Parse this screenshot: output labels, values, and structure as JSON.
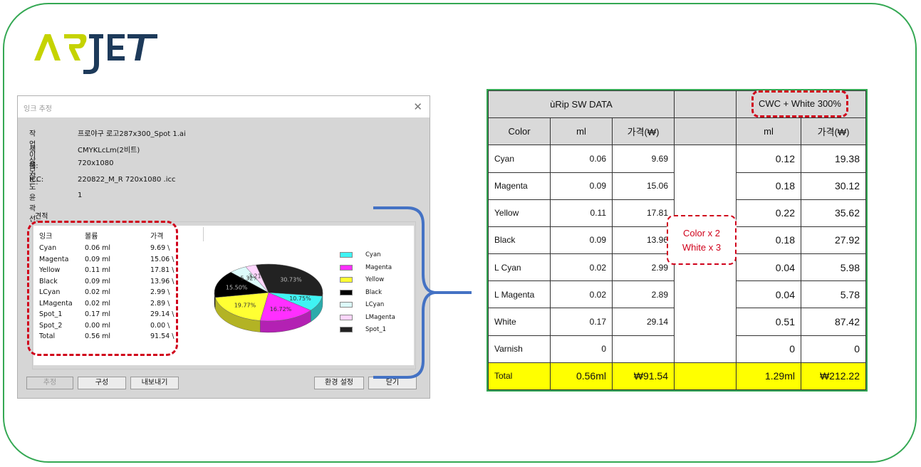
{
  "dialog": {
    "title": "잉크 추정",
    "fields": [
      {
        "key": "작업 이름:",
        "value": "프로야구 로고287x300_Spot 1.ai"
      },
      {
        "key": "색상 모드:",
        "value": "CMYKLcLm(2비트)"
      },
      {
        "key": "해상도",
        "value": "720x1080"
      },
      {
        "key": "ICC:",
        "value": "220822_M_R 720x1080 .icc"
      },
      {
        "key": "윤곽선:",
        "value": "1"
      }
    ],
    "group_label": "견적",
    "ink_headers": [
      "잉크",
      "볼륨",
      "가격"
    ],
    "inks": [
      {
        "name": "Cyan",
        "volume": "0.06 ml",
        "price": "9.69 \\"
      },
      {
        "name": "Magenta",
        "volume": "0.09 ml",
        "price": "15.06 \\"
      },
      {
        "name": "Yellow",
        "volume": "0.11 ml",
        "price": "17.81 \\"
      },
      {
        "name": "Black",
        "volume": "0.09 ml",
        "price": "13.96 \\"
      },
      {
        "name": "LCyan",
        "volume": "0.02 ml",
        "price": "2.99 \\"
      },
      {
        "name": "LMagenta",
        "volume": "0.02 ml",
        "price": "2.89 \\"
      },
      {
        "name": "Spot_1",
        "volume": "0.17 ml",
        "price": "29.14 \\"
      },
      {
        "name": "Spot_2",
        "volume": "0.00 ml",
        "price": "0.00 \\"
      },
      {
        "name": "Total",
        "volume": "0.56 ml",
        "price": "91.54 \\"
      }
    ],
    "pie_labels": [
      "30.73%",
      "10.75%",
      "16.72%",
      "19.77%",
      "15.50%",
      "5.32%",
      "3.21%"
    ],
    "legend": [
      {
        "label": "Cyan",
        "color": "#3ff4f4"
      },
      {
        "label": "Magenta",
        "color": "#ff2fff"
      },
      {
        "label": "Yellow",
        "color": "#ffff33"
      },
      {
        "label": "Black",
        "color": "#000000"
      },
      {
        "label": "LCyan",
        "color": "#dcfbfb"
      },
      {
        "label": "LMagenta",
        "color": "#ffd6ff"
      },
      {
        "label": "Spot_1",
        "color": "#222222"
      }
    ],
    "buttons": {
      "estimate": "추정",
      "config": "구성",
      "export": "내보내기",
      "settings": "환경 설정",
      "close": "닫기"
    }
  },
  "table": {
    "group1_header": "ùRip SW DATA",
    "group2_header": "CWC + White 300%",
    "col_headers": [
      "Color",
      "ml",
      "가격(₩)",
      "",
      "ml",
      "가격(₩)"
    ],
    "note_line1": "Color x 2",
    "note_line2": "White x 3",
    "rows": [
      {
        "color": "Cyan",
        "ml": "0.06",
        "price": "9.69",
        "ml2": "0.12",
        "price2": "19.38"
      },
      {
        "color": "Magenta",
        "ml": "0.09",
        "price": "15.06",
        "ml2": "0.18",
        "price2": "30.12"
      },
      {
        "color": "Yellow",
        "ml": "0.11",
        "price": "17.81",
        "ml2": "0.22",
        "price2": "35.62"
      },
      {
        "color": "Black",
        "ml": "0.09",
        "price": "13.96",
        "ml2": "0.18",
        "price2": "27.92"
      },
      {
        "color": "L Cyan",
        "ml": "0.02",
        "price": "2.99",
        "ml2": "0.04",
        "price2": "5.98"
      },
      {
        "color": "L Magenta",
        "ml": "0.02",
        "price": "2.89",
        "ml2": "0.04",
        "price2": "5.78"
      },
      {
        "color": "White",
        "ml": "0.17",
        "price": "29.14",
        "ml2": "0.51",
        "price2": "87.42"
      },
      {
        "color": "Varnish",
        "ml": "0",
        "price": "",
        "ml2": "0",
        "price2": "0"
      }
    ],
    "total": {
      "label": "Total",
      "ml": "0.56ml",
      "price": "₩91.54",
      "ml2": "1.29ml",
      "price2": "₩212.22"
    }
  },
  "colors": {
    "frame": "#34a853",
    "highlight": "#d0021b",
    "total_bg": "#ffff00",
    "bracket": "#4472c4"
  }
}
